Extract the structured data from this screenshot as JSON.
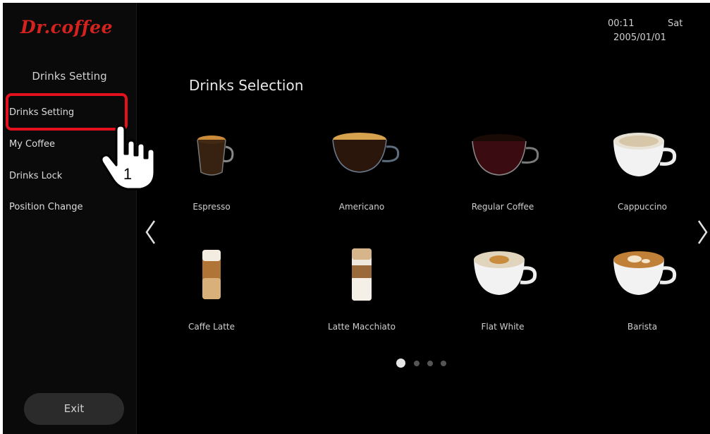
{
  "brand": {
    "logo_text": "Dr.coffee",
    "accent": "#d4231f"
  },
  "header": {
    "time": "00:11",
    "day": "Sat",
    "date": "2005/01/01"
  },
  "sidebar": {
    "title": "Drinks Setting",
    "items": [
      {
        "label": "Drinks Setting",
        "selected": true
      },
      {
        "label": "My Coffee"
      },
      {
        "label": "Drinks Lock"
      },
      {
        "label": "Position Change"
      }
    ],
    "exit_label": "Exit"
  },
  "main": {
    "title": "Drinks Selection",
    "drinks": [
      {
        "label": "Espresso",
        "icon": "espresso-glass-icon"
      },
      {
        "label": "Americano",
        "icon": "americano-glass-icon"
      },
      {
        "label": "Regular Coffee",
        "icon": "regular-coffee-glass-icon"
      },
      {
        "label": "Cappuccino",
        "icon": "cappuccino-cup-icon"
      },
      {
        "label": "Caffe Latte",
        "icon": "caffe-latte-glass-icon"
      },
      {
        "label": "Latte Macchiato",
        "icon": "latte-macchiato-glass-icon"
      },
      {
        "label": "Flat White",
        "icon": "flat-white-cup-icon"
      },
      {
        "label": "Barista",
        "icon": "barista-cup-icon"
      }
    ],
    "pager": {
      "pages": 4,
      "current": 1
    }
  },
  "annotation": {
    "step_number": "1",
    "highlight_color": "#e3101e"
  }
}
